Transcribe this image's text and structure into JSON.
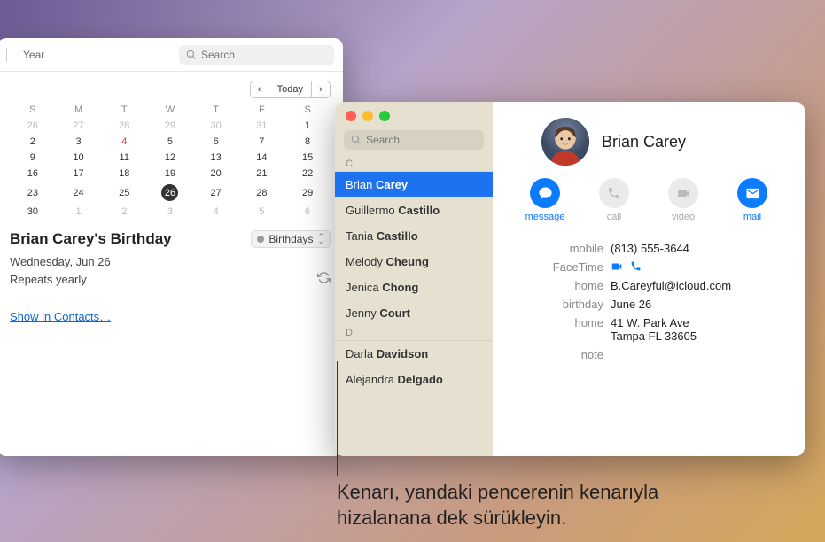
{
  "calendar": {
    "tabs": {
      "year": "Year"
    },
    "search_placeholder": "Search",
    "nav": {
      "today": "Today",
      "prev": "‹",
      "next": "›"
    },
    "dow": [
      "S",
      "M",
      "T",
      "W",
      "T",
      "F",
      "S"
    ],
    "weeks": [
      [
        {
          "d": "26",
          "dim": true
        },
        {
          "d": "27",
          "dim": true
        },
        {
          "d": "28",
          "dim": true
        },
        {
          "d": "29",
          "dim": true
        },
        {
          "d": "30",
          "dim": true
        },
        {
          "d": "31",
          "dim": true
        },
        {
          "d": "1"
        }
      ],
      [
        {
          "d": "2"
        },
        {
          "d": "3"
        },
        {
          "d": "4",
          "red": true
        },
        {
          "d": "5"
        },
        {
          "d": "6"
        },
        {
          "d": "7"
        },
        {
          "d": "8"
        }
      ],
      [
        {
          "d": "9"
        },
        {
          "d": "10"
        },
        {
          "d": "11"
        },
        {
          "d": "12"
        },
        {
          "d": "13"
        },
        {
          "d": "14"
        },
        {
          "d": "15"
        }
      ],
      [
        {
          "d": "16"
        },
        {
          "d": "17"
        },
        {
          "d": "18"
        },
        {
          "d": "19"
        },
        {
          "d": "20"
        },
        {
          "d": "21"
        },
        {
          "d": "22"
        }
      ],
      [
        {
          "d": "23"
        },
        {
          "d": "24"
        },
        {
          "d": "25"
        },
        {
          "d": "26",
          "sel": true
        },
        {
          "d": "27"
        },
        {
          "d": "28"
        },
        {
          "d": "29"
        }
      ],
      [
        {
          "d": "30"
        },
        {
          "d": "1",
          "dim": true
        },
        {
          "d": "2",
          "dim": true
        },
        {
          "d": "3",
          "dim": true
        },
        {
          "d": "4",
          "dim": true
        },
        {
          "d": "5",
          "dim": true
        },
        {
          "d": "6",
          "dim": true
        }
      ]
    ],
    "event": {
      "title": "Brian Carey's Birthday",
      "calendar_label": "Birthdays",
      "date": "Wednesday, Jun 26",
      "repeat": "Repeats yearly",
      "show_link": "Show in Contacts…"
    }
  },
  "contacts": {
    "search_placeholder": "Search",
    "sections": [
      {
        "letter": "C",
        "items": [
          {
            "first": "Brian",
            "last": "Carey",
            "selected": true
          },
          {
            "first": "Guillermo",
            "last": "Castillo"
          },
          {
            "first": "Tania",
            "last": "Castillo"
          },
          {
            "first": "Melody",
            "last": "Cheung"
          },
          {
            "first": "Jenica",
            "last": "Chong"
          },
          {
            "first": "Jenny",
            "last": "Court"
          }
        ]
      },
      {
        "letter": "D",
        "items": [
          {
            "first": "Darla",
            "last": "Davidson"
          },
          {
            "first": "Alejandra",
            "last": "Delgado"
          }
        ]
      }
    ],
    "detail": {
      "name": "Brian Carey",
      "actions": {
        "message": "message",
        "call": "call",
        "video": "video",
        "mail": "mail"
      },
      "rows": [
        {
          "label": "mobile",
          "value": "(813) 555-3644"
        },
        {
          "label": "FaceTime",
          "value": "",
          "ft": true
        },
        {
          "label": "home",
          "value": "B.Careyful@icloud.com"
        },
        {
          "label": "birthday",
          "value": "June 26"
        },
        {
          "label": "home",
          "value": "41 W. Park Ave\nTampa FL 33605"
        },
        {
          "label": "note",
          "value": ""
        }
      ]
    }
  },
  "caption": "Kenarı, yandaki pencerenin kenarıyla\nhizalanana dek sürükleyin."
}
